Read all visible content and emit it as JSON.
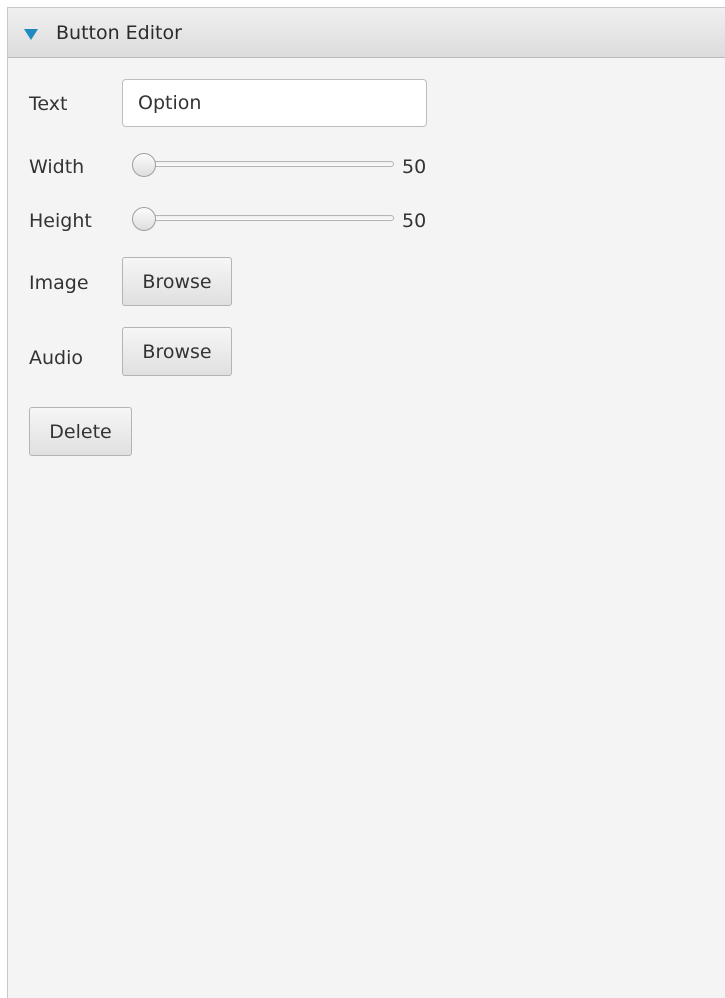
{
  "panel": {
    "title": "Button Editor",
    "collapse_icon": "triangle-down-icon",
    "accent_color": "#1f8ac0"
  },
  "fields": {
    "text": {
      "label": "Text",
      "value": "Option"
    },
    "width": {
      "label": "Width",
      "value": "50",
      "slider_fraction": 0
    },
    "height": {
      "label": "Height",
      "value": "50",
      "slider_fraction": 0
    },
    "image": {
      "label": "Image",
      "button_label": "Browse"
    },
    "audio": {
      "label": "Audio",
      "button_label": "Browse"
    }
  },
  "delete_button": {
    "label": "Delete"
  }
}
